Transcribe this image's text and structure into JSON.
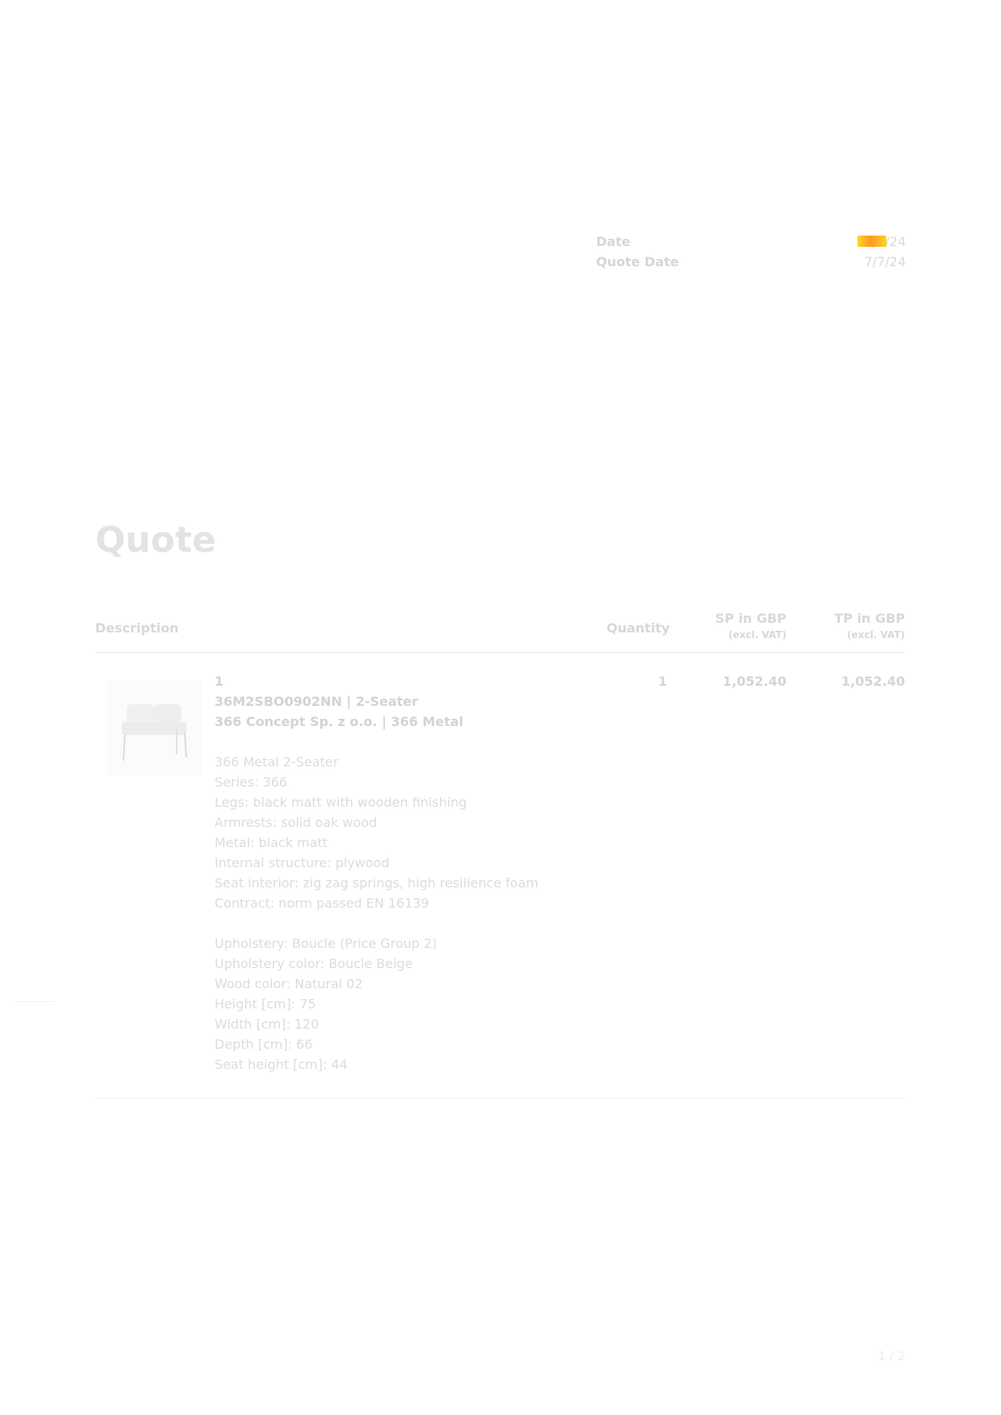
{
  "meta": {
    "date_label": "Date",
    "date_value": "7/7/24",
    "quote_date_label": "Quote Date",
    "quote_date_value": "7/7/24"
  },
  "title": "Quote",
  "table": {
    "headers": {
      "description": "Description",
      "quantity": "Quantity",
      "sp": "SP in GBP",
      "sp_sub": "(excl. VAT)",
      "tp": "TP in GBP",
      "tp_sub": "(excl. VAT)"
    },
    "row": {
      "position": "1",
      "code_line": "36M2SBO0902NN | 2-Seater",
      "maker_line": "366 Concept Sp. z o.o. | 366 Metal",
      "details": [
        "366 Metal 2-Seater",
        "Series: 366",
        "Legs: black matt with wooden finishing",
        "Armrests: solid oak wood",
        "Metal: black matt",
        "Internal structure: plywood",
        "Seat interior: zig zag springs, high resilience foam",
        "Contract: norm passed EN 16139"
      ],
      "options": [
        "Upholstery: Boucle (Price Group 2)",
        "Upholstery color: Boucle Beige",
        "Wood color: Natural 02",
        "Height [cm]: 75",
        "Width [cm]: 120",
        "Depth [cm]: 66",
        "Seat height [cm]: 44"
      ],
      "quantity": "1",
      "sp": "1,052.40",
      "tp": "1,052.40"
    }
  },
  "page_number": "1 / 2",
  "colors": {
    "date_highlight": "#ff9f00",
    "text_faint": "#d8d8d8"
  }
}
